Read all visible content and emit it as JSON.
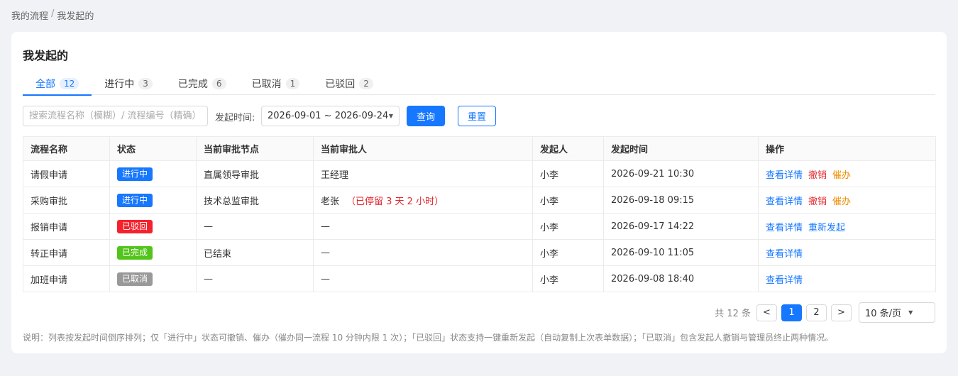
{
  "breadcrumb": {
    "root": "我的流程",
    "separator": "/",
    "current": "我发起的"
  },
  "page_title": "我发起的",
  "tabs": [
    {
      "label": "全部",
      "count": "12"
    },
    {
      "label": "进行中",
      "count": "3"
    },
    {
      "label": "已完成",
      "count": "6"
    },
    {
      "label": "已取消",
      "count": "1"
    },
    {
      "label": "已驳回",
      "count": "2"
    }
  ],
  "filters": {
    "search_placeholder": "搜索流程名称（模糊）/ 流程编号（精确）",
    "date_label": "发起时间:",
    "date_range": "2026-09-01 ~ 2026-09-24",
    "query_label": "查询",
    "reset_label": "重置"
  },
  "table": {
    "headers": [
      "流程名称",
      "状态",
      "当前审批节点",
      "当前审批人",
      "发起人",
      "发起时间",
      "操作"
    ],
    "rows": [
      {
        "name": "请假申请",
        "status": "进行中",
        "status_color": "#1677ff",
        "node": "直属领导审批",
        "approver": "王经理",
        "stay": "",
        "initiator": "小李",
        "time": "2026-09-21 10:30",
        "actions": [
          {
            "label": "查看详情",
            "kind": "detail"
          },
          {
            "label": "撤销",
            "kind": "cancel"
          },
          {
            "label": "催办",
            "kind": "urge"
          }
        ]
      },
      {
        "name": "采购审批",
        "status": "进行中",
        "status_color": "#1677ff",
        "node": "技术总监审批",
        "approver": "老张",
        "stay": "（已停留 3 天 2 小时）",
        "initiator": "小李",
        "time": "2026-09-18 09:15",
        "actions": [
          {
            "label": "查看详情",
            "kind": "detail"
          },
          {
            "label": "撤销",
            "kind": "cancel"
          },
          {
            "label": "催办",
            "kind": "urge"
          }
        ]
      },
      {
        "name": "报销申请",
        "status": "已驳回",
        "status_color": "#f5222d",
        "node": "—",
        "approver": "—",
        "stay": "",
        "initiator": "小李",
        "time": "2026-09-17 14:22",
        "actions": [
          {
            "label": "查看详情",
            "kind": "detail"
          },
          {
            "label": "重新发起",
            "kind": "detail"
          }
        ]
      },
      {
        "name": "转正申请",
        "status": "已完成",
        "status_color": "#52c41a",
        "node": "已结束",
        "approver": "—",
        "stay": "",
        "initiator": "小李",
        "time": "2026-09-10 11:05",
        "actions": [
          {
            "label": "查看详情",
            "kind": "detail"
          }
        ]
      },
      {
        "name": "加班申请",
        "status": "已取消",
        "status_color": "#999999",
        "node": "—",
        "approver": "—",
        "stay": "",
        "initiator": "小李",
        "time": "2026-09-08 18:40",
        "actions": [
          {
            "label": "查看详情",
            "kind": "detail"
          }
        ]
      }
    ]
  },
  "pagination": {
    "total": "共 12 条",
    "prev": "<",
    "next": ">",
    "pages": [
      "1",
      "2"
    ],
    "page_size": "10 条/页"
  },
  "note": "说明：列表按发起时间倒序排列；仅「进行中」状态可撤销、催办（催办同一流程 10 分钟内限 1 次）；「已驳回」状态支持一键重新发起（自动复制上次表单数据）；「已取消」包含发起人撤销与管理员终止两种情况。",
  "colors": {
    "accent": "#1677ff",
    "danger": "#e0282e",
    "warning": "#f08c00"
  }
}
